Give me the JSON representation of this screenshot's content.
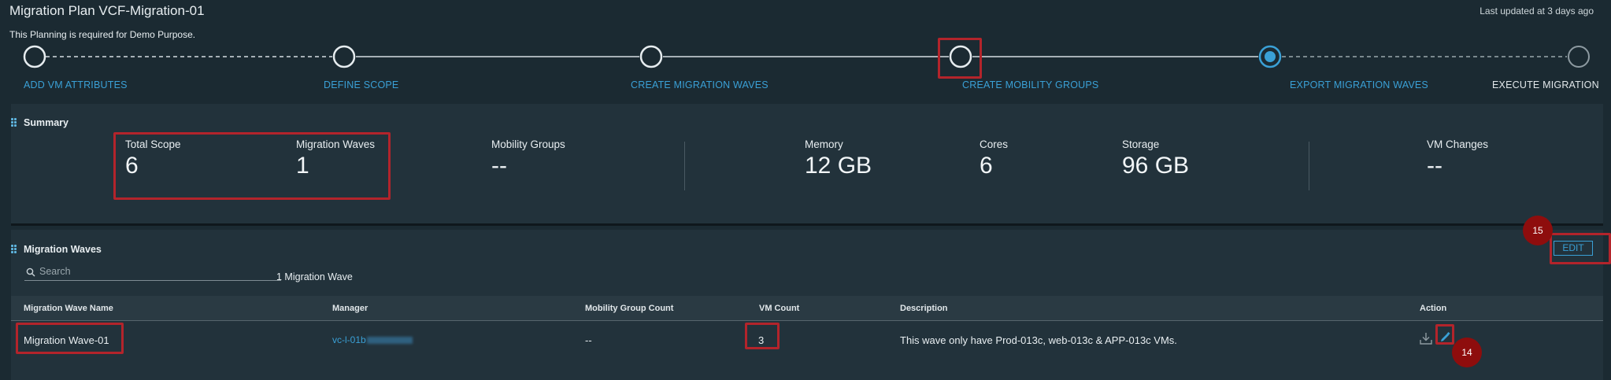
{
  "header": {
    "title": "Migration Plan VCF-Migration-01",
    "last_updated": "Last updated at 3 days ago",
    "subtitle": "This Planning is required for Demo Purpose."
  },
  "stepper": {
    "steps": [
      {
        "label": "ADD VM ATTRIBUTES",
        "state": "completed"
      },
      {
        "label": "DEFINE SCOPE",
        "state": "completed"
      },
      {
        "label": "CREATE MIGRATION WAVES",
        "state": "completed"
      },
      {
        "label": "CREATE MOBILITY GROUPS",
        "state": "completed"
      },
      {
        "label": "EXPORT MIGRATION WAVES",
        "state": "current"
      },
      {
        "label": "EXECUTE MIGRATION",
        "state": "pending"
      }
    ]
  },
  "summary": {
    "title": "Summary",
    "metrics": {
      "total_scope": {
        "label": "Total Scope",
        "value": "6"
      },
      "migration_waves": {
        "label": "Migration Waves",
        "value": "1"
      },
      "mobility_groups": {
        "label": "Mobility Groups",
        "value": "--"
      },
      "memory": {
        "label": "Memory",
        "value": "12 GB"
      },
      "cores": {
        "label": "Cores",
        "value": "6"
      },
      "storage": {
        "label": "Storage",
        "value": "96 GB"
      },
      "vm_changes": {
        "label": "VM Changes",
        "value": "--"
      }
    }
  },
  "waves": {
    "title": "Migration Waves",
    "search_placeholder": "Search",
    "count_text": "1 Migration Wave",
    "edit_label": "EDIT",
    "columns": [
      "Migration Wave Name",
      "Manager",
      "Mobility Group Count",
      "VM Count",
      "Description",
      "Action"
    ],
    "rows": [
      {
        "name": "Migration Wave-01",
        "manager": "vc-l-01b",
        "mobility_group_count": "--",
        "vm_count": "3",
        "description": "This wave only have Prod-013c, web-013c & APP-013c VMs."
      }
    ]
  },
  "annotations": {
    "badge_15": "15",
    "badge_14": "14"
  },
  "colors": {
    "background": "#1b2a32",
    "panel": "#22323b",
    "accent": "#3aa0d6",
    "highlight_box": "#b3242b",
    "badge": "#8e0d0d"
  }
}
